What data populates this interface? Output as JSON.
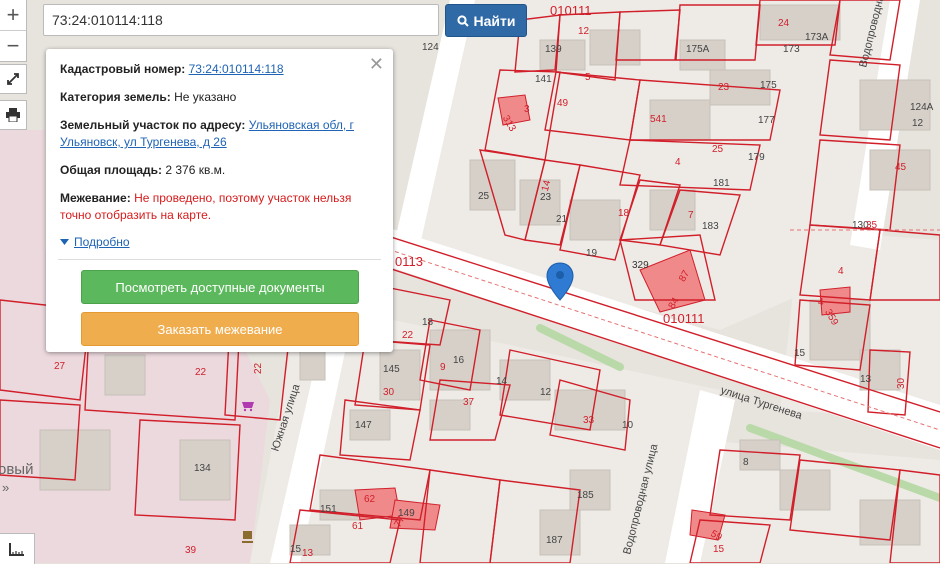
{
  "search": {
    "value": "73:24:010114:118",
    "button_label": "Найти"
  },
  "map_controls": {
    "zoom_in": "+",
    "zoom_out": "−"
  },
  "popup": {
    "cadastral_number_label": "Кадастровый номер:",
    "cadastral_number_value": "73:24:010114:118",
    "category_label": "Категория земель:",
    "category_value": "Не указано",
    "address_label": "Земельный участок по адресу:",
    "address_value_line1": "Ульяновская обл, г",
    "address_value_line2": "Ульяновск, ул Тургенева, д 26",
    "area_label": "Общая площадь:",
    "area_value": "2 376 кв.м.",
    "survey_label": "Межевание:",
    "survey_value_line1": "Не проведено, поэтому участок нельзя",
    "survey_value_line2": "точно отобразить на карте.",
    "more_label": "Подробно",
    "docs_button": "Посмотреть доступные документы",
    "order_button": "Заказать межевание"
  },
  "map": {
    "streets": {
      "turgeneva": "улица Тургенева",
      "yuzhnaya": "Южная улица",
      "vodoprovodnaya_bottom": "Водопроводная улица",
      "vodoprovodnaya_top": "Водопроводная улица"
    },
    "quarters": {
      "q1": "010111",
      "q2": "010111",
      "q3": "0113"
    },
    "fragments": {
      "left_label": "овый",
      "left_quote": "»"
    },
    "parcels": {
      "p139": "139",
      "p141": "141",
      "p5": "5",
      "p49": "49",
      "p3": "3",
      "p313": "3​13",
      "p12": "12",
      "p24": "24",
      "p175a": "175А",
      "p173": "173",
      "p173a": "173А",
      "p23": "23",
      "p175": "175",
      "p541": "541",
      "p177": "177",
      "p25": "25",
      "p179": "179",
      "p4": "4",
      "p181": "181",
      "p7": "7",
      "p183": "183",
      "p18": "18",
      "p14": "14",
      "p23b": "23",
      "p21": "21",
      "p25b": "25",
      "p19": "19",
      "p329": "329",
      "p87": "87",
      "p84": "84",
      "p124": "124",
      "p124a": "124А",
      "p12b": "12",
      "p45": "45",
      "p130": "130",
      "p35": "35",
      "p4b": "4",
      "p4c": "4",
      "p359": "359",
      "p15": "15",
      "p13": "13",
      "p30": "30",
      "p22": "22",
      "p18b": "18",
      "p145": "145",
      "p9": "9",
      "p16": "16",
      "p14b": "14",
      "p30b": "30",
      "p37": "37",
      "p12c": "12",
      "p33": "33",
      "p10": "10",
      "p147": "147",
      "p27": "27",
      "p22b": "22",
      "p22c": "22",
      "p134": "134",
      "p185": "185",
      "p187": "187",
      "p62": "62",
      "p151": "151",
      "p61": "61",
      "p149": "149",
      "p77": "77",
      "p15b": "15",
      "p13b": "13",
      "p8": "8",
      "p59": "59",
      "p15c": "15",
      "p39": "39"
    }
  },
  "colors": {
    "accent_blue": "#2f6aa7",
    "boundary_red": "#d11f2a",
    "highlight_pink": "#f08a8a"
  }
}
